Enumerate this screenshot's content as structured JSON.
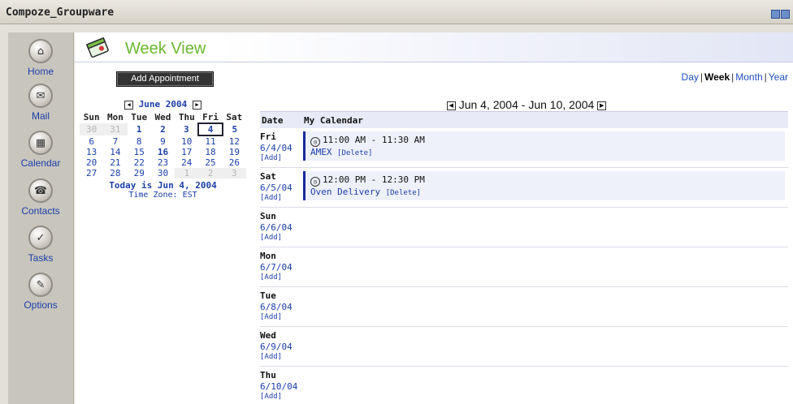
{
  "window": {
    "title": "Compoze_Groupware"
  },
  "nav": {
    "items": [
      {
        "label": "Home",
        "icon": "home-icon"
      },
      {
        "label": "Mail",
        "icon": "mail-icon"
      },
      {
        "label": "Calendar",
        "icon": "calendar-icon"
      },
      {
        "label": "Contacts",
        "icon": "contacts-icon"
      },
      {
        "label": "Tasks",
        "icon": "tasks-icon"
      },
      {
        "label": "Options",
        "icon": "options-icon"
      }
    ]
  },
  "page": {
    "title": "Week View",
    "add_button": "Add Appointment"
  },
  "views": {
    "day": "Day",
    "week": "Week",
    "month": "Month",
    "year": "Year",
    "separator": "|"
  },
  "mini_calendar": {
    "month_label": "June 2004",
    "weekdays": [
      "Sun",
      "Mon",
      "Tue",
      "Wed",
      "Thu",
      "Fri",
      "Sat"
    ],
    "weeks": [
      [
        "30",
        "31",
        "1",
        "2",
        "3",
        "4",
        "5"
      ],
      [
        "6",
        "7",
        "8",
        "9",
        "10",
        "11",
        "12"
      ],
      [
        "13",
        "14",
        "15",
        "16",
        "17",
        "18",
        "19"
      ],
      [
        "20",
        "21",
        "22",
        "23",
        "24",
        "25",
        "26"
      ],
      [
        "27",
        "28",
        "29",
        "30",
        "1",
        "2",
        "3"
      ]
    ],
    "today_text": "Today is Jun 4, 2004",
    "timezone_text": "Time Zone: EST"
  },
  "week": {
    "range_label": "Jun 4, 2004 - Jun 10, 2004",
    "col_date": "Date",
    "col_calendar": "My Calendar",
    "add_label": "[Add]",
    "delete_label": "[Delete]",
    "days": [
      {
        "name": "Fri",
        "date": "6/4/04",
        "appt_time": "11:00 AM - 11:30 AM",
        "appt_name": "AMEX"
      },
      {
        "name": "Sat",
        "date": "6/5/04",
        "appt_time": "12:00 PM - 12:30 PM",
        "appt_name": "Oven Delivery"
      },
      {
        "name": "Sun",
        "date": "6/6/04"
      },
      {
        "name": "Mon",
        "date": "6/7/04"
      },
      {
        "name": "Tue",
        "date": "6/8/04"
      },
      {
        "name": "Wed",
        "date": "6/9/04"
      },
      {
        "name": "Thu",
        "date": "6/10/04"
      }
    ]
  },
  "colors": {
    "accent_green": "#6bb82f",
    "link_blue": "#1b3fa8",
    "appt_bar": "#162a9b"
  }
}
